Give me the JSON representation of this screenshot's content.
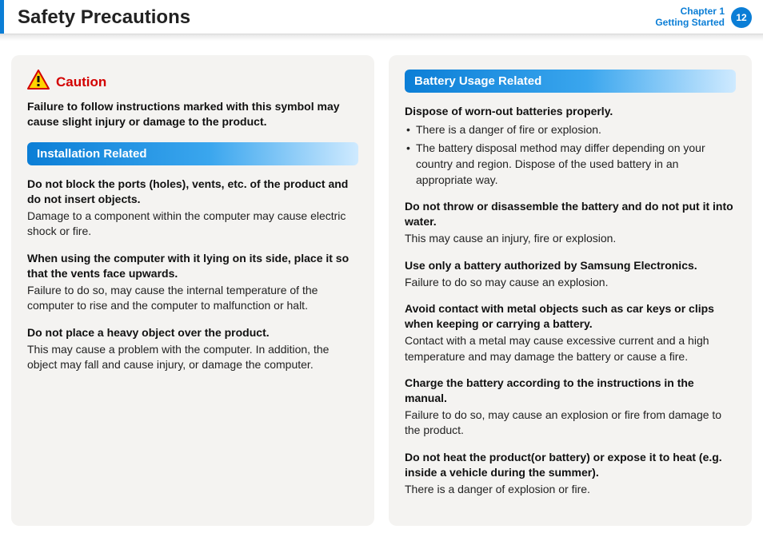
{
  "header": {
    "title": "Safety Precautions",
    "chapter_line1": "Chapter 1",
    "chapter_line2": "Getting Started",
    "page_number": "12"
  },
  "left": {
    "caution_label": "Caution",
    "caution_desc": "Failure to follow instructions marked with this symbol may cause slight injury or damage to the product.",
    "section_title": "Installation Related",
    "items": [
      {
        "heading": "Do not block the ports (holes), vents, etc. of the product and do not insert objects.",
        "body": "Damage to a component within the computer may cause electric shock or fire."
      },
      {
        "heading": "When using the computer with it lying on its side, place it so that the vents face upwards.",
        "body": "Failure to do so, may cause the internal temperature of the computer to rise and the computer to malfunction or halt."
      },
      {
        "heading": "Do not place a heavy object over the product.",
        "body": "This may cause a problem with the computer. In addition, the object may fall and cause injury, or damage the computer."
      }
    ]
  },
  "right": {
    "section_title": "Battery Usage Related",
    "items": [
      {
        "heading": "Dispose of worn-out batteries properly.",
        "bullets": [
          "There is a danger of fire or explosion.",
          "The battery disposal method may differ depending on your country and region. Dispose of the used battery in an appropriate way."
        ]
      },
      {
        "heading": "Do not throw or disassemble the battery and do not put it into water.",
        "body": "This may cause an injury, fire or explosion."
      },
      {
        "heading": "Use only a battery authorized by Samsung Electronics.",
        "body": "Failure to do so may cause an explosion."
      },
      {
        "heading": "Avoid contact with metal objects such as car keys or clips when keeping or carrying a battery.",
        "body": "Contact with a metal may cause excessive current and a high temperature and may damage the battery or cause a fire."
      },
      {
        "heading": "Charge the battery according to the instructions in the manual.",
        "body": "Failure to do so, may cause an explosion or fire from damage to the product."
      },
      {
        "heading": "Do not heat the product(or battery) or expose it to heat (e.g. inside a vehicle during the summer).",
        "body": "There is a danger of explosion or fire."
      }
    ]
  }
}
